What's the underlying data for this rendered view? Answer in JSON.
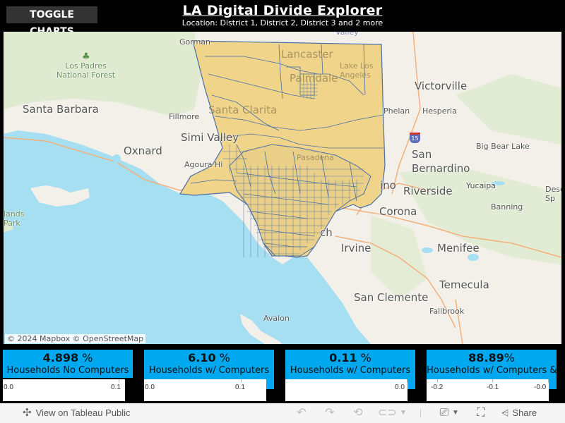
{
  "header": {
    "toggle_label": "TOGGLE CHARTS",
    "title": "LA Digital Divide Explorer",
    "subtitle": "Location: District 1, District 2, District 3 and 2 more"
  },
  "map": {
    "attribution": "© 2024 Mapbox  © OpenStreetMap",
    "highway_shield": "15",
    "colors": {
      "water": "#a6def2",
      "land": "#f3f0ea",
      "park": "#dfead0",
      "region_fill": "#f0d48a",
      "region_stroke": "#4a6fa5"
    },
    "labels": [
      {
        "id": "gorman",
        "text": "Gorman",
        "size": "sm"
      },
      {
        "id": "los-padres",
        "text": "Los Padres\nNational Forest",
        "size": "green"
      },
      {
        "id": "santa-barbara",
        "text": "Santa Barbara",
        "size": "lg"
      },
      {
        "id": "fillmore",
        "text": "Fillmore",
        "size": "sm"
      },
      {
        "id": "simi-valley",
        "text": "Simi Valley",
        "size": "lg"
      },
      {
        "id": "oxnard",
        "text": "Oxnard",
        "size": "lg"
      },
      {
        "id": "agoura-hills",
        "text": "Agoura Hi",
        "size": "sm"
      },
      {
        "id": "islands-park",
        "text": "lands\nPark",
        "size": "green"
      },
      {
        "id": "lancaster",
        "text": "Lancaster",
        "size": "lg"
      },
      {
        "id": "palmdale",
        "text": "Palmdale",
        "size": "lg"
      },
      {
        "id": "lake-los-angeles",
        "text": "Lake Los\nAngeles",
        "size": "sm"
      },
      {
        "id": "santa-clarita",
        "text": "Santa Clarita",
        "size": "lg"
      },
      {
        "id": "pasadena",
        "text": "Pasadena",
        "size": "sm"
      },
      {
        "id": "valley",
        "text": "Valley",
        "size": "sm"
      },
      {
        "id": "victorville",
        "text": "Victorville",
        "size": "lg"
      },
      {
        "id": "phelan",
        "text": "Phelan",
        "size": "sm"
      },
      {
        "id": "hesperia",
        "text": "Hesperia",
        "size": "sm"
      },
      {
        "id": "big-bear-lake",
        "text": "Big Bear Lake",
        "size": "sm"
      },
      {
        "id": "san-bernardino",
        "text": "San\nBernardino",
        "size": "lg"
      },
      {
        "id": "ontario",
        "text": "ino",
        "size": "lg"
      },
      {
        "id": "riverside",
        "text": "Riverside",
        "size": "lg"
      },
      {
        "id": "yucaipa",
        "text": "Yucaipa",
        "size": "sm"
      },
      {
        "id": "desert-springs",
        "text": "Dese\nSp",
        "size": "sm"
      },
      {
        "id": "banning",
        "text": "Banning",
        "size": "sm"
      },
      {
        "id": "corona",
        "text": "Corona",
        "size": "lg"
      },
      {
        "id": "long-beach",
        "text": "ch",
        "size": "lg"
      },
      {
        "id": "irvine",
        "text": "Irvine",
        "size": "lg"
      },
      {
        "id": "menifee",
        "text": "Menifee",
        "size": "lg"
      },
      {
        "id": "temecula",
        "text": "Temecula",
        "size": "lg"
      },
      {
        "id": "san-clemente",
        "text": "San Clemente",
        "size": "lg"
      },
      {
        "id": "fallbrook",
        "text": "Fallbrook",
        "size": "sm"
      },
      {
        "id": "avalon",
        "text": "Avalon",
        "size": "sm"
      }
    ]
  },
  "kpis": [
    {
      "value": "4.898",
      "unit": " %",
      "label": "Households No Computers",
      "axis_ticks": [
        "0.0",
        "0.1"
      ]
    },
    {
      "value": "6.10",
      "unit": " %",
      "label": "Households w/ Computers",
      "axis_ticks": [
        "0.0",
        "0.1"
      ]
    },
    {
      "value": "0.11",
      "unit": " %",
      "label": "Households w/ Computers",
      "axis_ticks": [
        "0.0"
      ]
    },
    {
      "value": "88.89",
      "unit": "%",
      "label": "Households w/ Computers &",
      "axis_ticks": [
        "-0.2",
        "-0.1",
        "-0.0"
      ]
    }
  ],
  "footer": {
    "view_on_label": "View on Tableau Public",
    "share_label": "Share",
    "icons": [
      "tableau-logo-icon",
      "undo-icon",
      "redo-icon",
      "revert-icon",
      "refresh-icon",
      "pause-dropdown-icon",
      "download-icon",
      "fullscreen-icon",
      "share-icon"
    ]
  }
}
